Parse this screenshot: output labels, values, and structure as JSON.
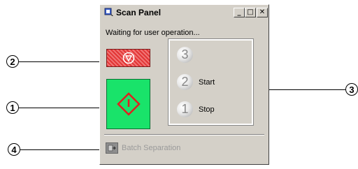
{
  "window": {
    "title": "Scan Panel",
    "buttons": {
      "minimize": "_",
      "maximize": "□",
      "close": "✕"
    }
  },
  "status_text": "Waiting for user operation...",
  "buttons": {
    "stop_icon": "stop-icon",
    "start_icon": "start-icon",
    "batch_separation_label": "Batch Separation"
  },
  "counter": {
    "rows": [
      {
        "digit": "3",
        "label": ""
      },
      {
        "digit": "2",
        "label": "Start"
      },
      {
        "digit": "1",
        "label": "Stop"
      }
    ]
  },
  "callouts": {
    "one": "1",
    "two": "2",
    "three": "3",
    "four": "4"
  },
  "colors": {
    "start_green": "#19e36a",
    "stop_red": "#e23535"
  }
}
